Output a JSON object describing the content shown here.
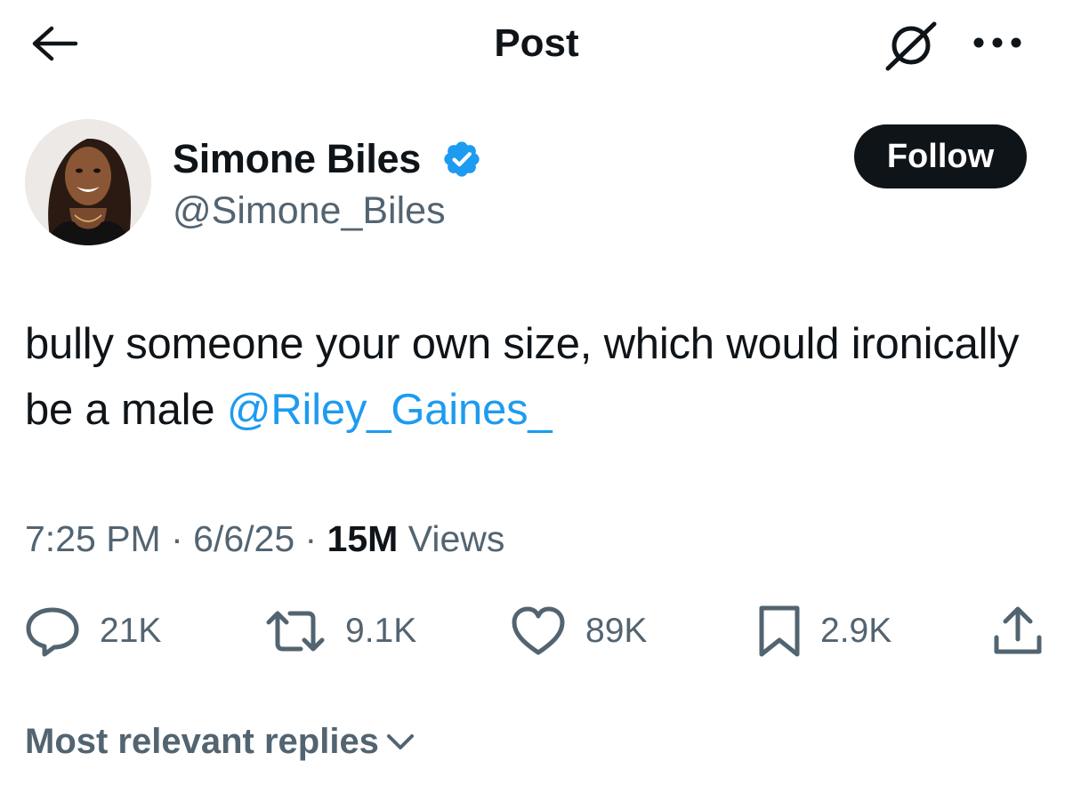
{
  "header": {
    "title": "Post",
    "back_icon": "arrow-left-icon",
    "grok_icon": "grok-icon",
    "more_icon": "more-horizontal-icon"
  },
  "author": {
    "name": "Simone Biles",
    "handle": "@Simone_Biles",
    "verified": true,
    "verified_color": "#1d9bf0",
    "follow_label": "Follow"
  },
  "tweet": {
    "text": "bully someone your own size, which would ironically be a male ",
    "mention": "@Riley_Gaines_",
    "mention_color": "#1d9bf0"
  },
  "meta": {
    "time": "7:25 PM",
    "sep1": " · ",
    "date": "6/6/25",
    "sep2": " · ",
    "views_count": "15M",
    "views_label": " Views"
  },
  "actions": {
    "replies": "21K",
    "reposts": "9.1K",
    "likes": "89K",
    "bookmarks": "2.9K"
  },
  "replies_sort": {
    "label": "Most relevant replies"
  },
  "colors": {
    "text": "#0f1419",
    "secondary": "#536471",
    "accent": "#1d9bf0"
  }
}
